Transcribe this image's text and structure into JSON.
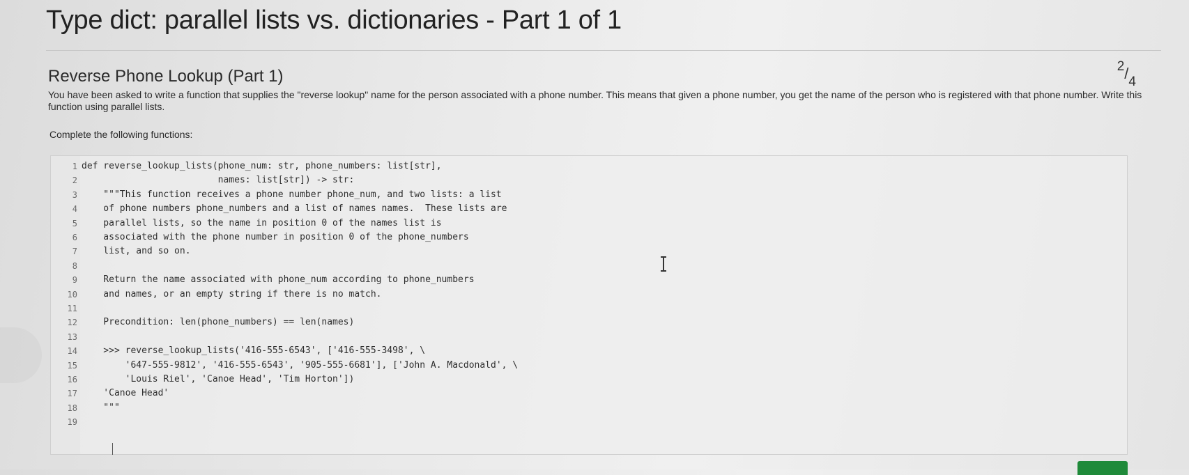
{
  "page": {
    "title": "Type dict: parallel lists vs. dictionaries - Part 1 of 1"
  },
  "question": {
    "title": "Reverse Phone Lookup (Part 1)",
    "progress_current": "2",
    "progress_total": "4",
    "description": "You have been asked to write a function that supplies the \"reverse lookup\" name for the person associated with a phone number. This means that given a phone number, you get the name of the person who is registered with that phone number. Write this function using parallel lists.",
    "instruction": "Complete the following functions:"
  },
  "editor": {
    "lines": [
      {
        "num": "1",
        "code": "def reverse_lookup_lists(phone_num: str, phone_numbers: list[str],"
      },
      {
        "num": "2",
        "code": "                         names: list[str]) -> str:"
      },
      {
        "num": "3",
        "code": "    \"\"\"This function receives a phone number phone_num, and two lists: a list"
      },
      {
        "num": "4",
        "code": "    of phone numbers phone_numbers and a list of names names.  These lists are"
      },
      {
        "num": "5",
        "code": "    parallel lists, so the name in position 0 of the names list is"
      },
      {
        "num": "6",
        "code": "    associated with the phone number in position 0 of the phone_numbers"
      },
      {
        "num": "7",
        "code": "    list, and so on."
      },
      {
        "num": "8",
        "code": ""
      },
      {
        "num": "9",
        "code": "    Return the name associated with phone_num according to phone_numbers"
      },
      {
        "num": "10",
        "code": "    and names, or an empty string if there is no match."
      },
      {
        "num": "11",
        "code": ""
      },
      {
        "num": "12",
        "code": "    Precondition: len(phone_numbers) == len(names)"
      },
      {
        "num": "13",
        "code": ""
      },
      {
        "num": "14",
        "code": "    >>> reverse_lookup_lists('416-555-6543', ['416-555-3498', \\"
      },
      {
        "num": "15",
        "code": "        '647-555-9812', '416-555-6543', '905-555-6681'], ['John A. Macdonald', \\"
      },
      {
        "num": "16",
        "code": "        'Louis Riel', 'Canoe Head', 'Tim Horton'])"
      },
      {
        "num": "17",
        "code": "    'Canoe Head'"
      },
      {
        "num": "18",
        "code": "    \"\"\""
      },
      {
        "num": "19",
        "code": ""
      }
    ]
  },
  "icons": {
    "cursor": "text-ibeam-icon"
  },
  "colors": {
    "submit_button": "#1f8a3a"
  }
}
